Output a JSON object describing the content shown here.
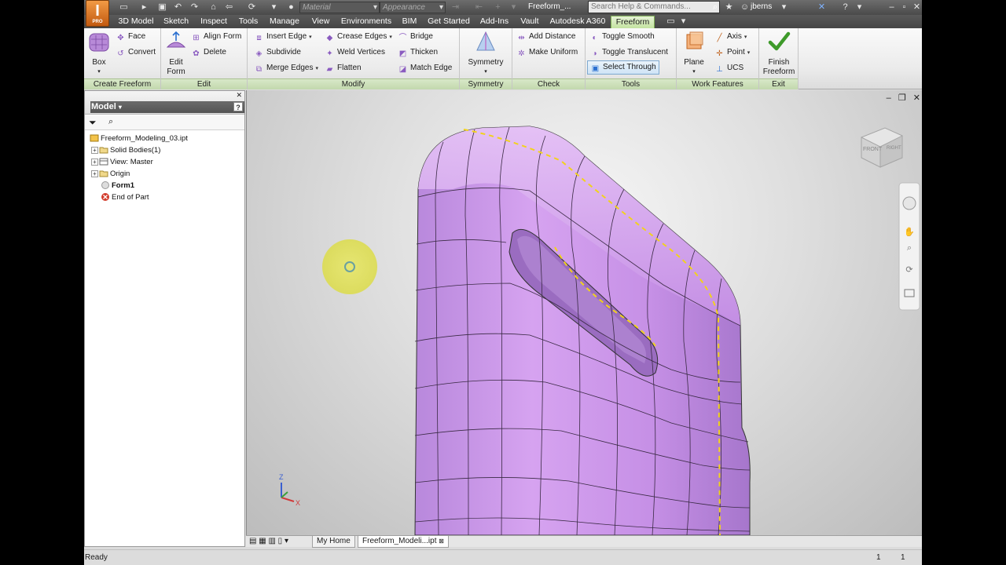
{
  "app": {
    "logo_letter": "I",
    "logo_sub": "PRO"
  },
  "qat": {
    "material_placeholder": "Material",
    "appearance_placeholder": "Appearance",
    "doc_title": "Freeform_...",
    "search_placeholder": "Search Help & Commands...",
    "user": "jberns"
  },
  "tabs": [
    "3D Model",
    "Sketch",
    "Inspect",
    "Tools",
    "Manage",
    "View",
    "Environments",
    "BIM",
    "Get Started",
    "Add-Ins",
    "Vault",
    "Autodesk A360",
    "Freeform"
  ],
  "ribbon": {
    "create_freeform": {
      "box": "Box",
      "face": "Face",
      "convert": "Convert",
      "label": "Create Freeform"
    },
    "edit": {
      "edit_form_l1": "Edit",
      "edit_form_l2": "Form",
      "align_form": "Align Form",
      "delete": "Delete",
      "label": "Edit"
    },
    "modify": {
      "insert_edge": "Insert Edge",
      "subdivide": "Subdivide",
      "merge_edges": "Merge Edges",
      "crease_edges": "Crease Edges",
      "weld_vertices": "Weld Vertices",
      "flatten": "Flatten",
      "bridge": "Bridge",
      "thicken": "Thicken",
      "match_edge": "Match Edge",
      "label": "Modify"
    },
    "symmetry": {
      "symmetry": "Symmetry",
      "label": "Symmetry"
    },
    "check": {
      "add_distance": "Add Distance",
      "make_uniform": "Make Uniform",
      "label": "Check"
    },
    "tools": {
      "toggle_smooth": "Toggle Smooth",
      "toggle_translucent": "Toggle Translucent",
      "select_through": "Select Through",
      "label": "Tools"
    },
    "work_features": {
      "plane": "Plane",
      "axis": "Axis",
      "point": "Point",
      "ucs": "UCS",
      "label": "Work Features"
    },
    "exit": {
      "finish_l1": "Finish",
      "finish_l2": "Freeform",
      "label": "Exit"
    }
  },
  "browser": {
    "title": "Model",
    "items": [
      "Freeform_Modeling_03.ipt",
      "Solid Bodies(1)",
      "View: Master",
      "Origin",
      "Form1",
      "End of Part"
    ]
  },
  "viewcube": {
    "front": "FRONT",
    "right": "RIGHT"
  },
  "triad": {
    "z": "Z",
    "x": "X"
  },
  "doc_tabs": {
    "home": "My Home",
    "file": "Freeform_Modeli...ipt"
  },
  "status": {
    "left": "Ready",
    "n1": "1",
    "n2": "1"
  },
  "colors": {
    "form": "#c98fe6",
    "freeform_tab": "#c3e2a0",
    "symmetry_line": "#f2d21c"
  }
}
